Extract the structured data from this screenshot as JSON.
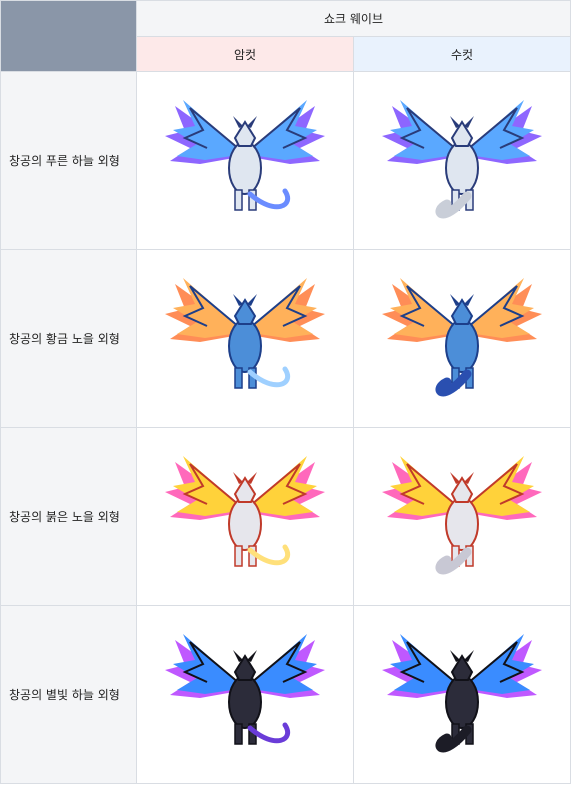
{
  "table": {
    "group_header": "쇼크 웨이브",
    "female_header": "암컷",
    "male_header": "수컷",
    "rows": [
      {
        "label": "창공의 푸른 하늘 외형",
        "female_icon": "blue-sky-dragon-female-icon",
        "male_icon": "blue-sky-dragon-male-icon",
        "colors": {
          "body": "#dfe6f0",
          "wing": "#5aa8ff",
          "glow": "#7a4cff",
          "accent": "#2a3c7a",
          "tail_f": "#6a8cff",
          "tail_m": "#c9ced8"
        }
      },
      {
        "label": "창공의 황금 노을 외형",
        "female_icon": "golden-sunset-dragon-female-icon",
        "male_icon": "golden-sunset-dragon-male-icon",
        "colors": {
          "body": "#4c8ed8",
          "wing": "#ffb15a",
          "glow": "#ff7a3a",
          "accent": "#1d3f8a",
          "tail_f": "#9fd0ff",
          "tail_m": "#2a4fb0"
        }
      },
      {
        "label": "창공의 붉은 노을 외형",
        "female_icon": "red-sunset-dragon-female-icon",
        "male_icon": "red-sunset-dragon-male-icon",
        "colors": {
          "body": "#e6e6ec",
          "wing": "#ffd23a",
          "glow": "#ff4fb0",
          "accent": "#c03a2a",
          "tail_f": "#ffe07a",
          "tail_m": "#c8c8d4"
        }
      },
      {
        "label": "창공의 별빛 하늘 외형",
        "female_icon": "starlight-sky-dragon-female-icon",
        "male_icon": "starlight-sky-dragon-male-icon",
        "colors": {
          "body": "#2c2c3a",
          "wing": "#3a8cff",
          "glow": "#b43cff",
          "accent": "#111118",
          "tail_f": "#6a3cd8",
          "tail_m": "#1c1c26"
        }
      }
    ]
  }
}
